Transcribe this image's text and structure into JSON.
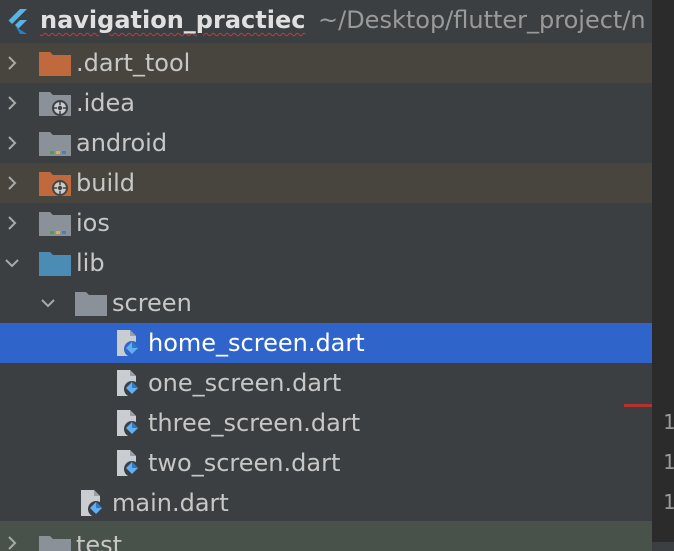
{
  "project": {
    "name": "navigation_practiec",
    "path": "~/Desktop/flutter_project/n"
  },
  "tree": [
    {
      "label": ".dart_tool",
      "icon": "folder-excluded-icon",
      "expanded": false
    },
    {
      "label": ".idea",
      "icon": "folder-settings-icon",
      "expanded": false
    },
    {
      "label": "android",
      "icon": "folder-android-icon",
      "expanded": false
    },
    {
      "label": "build",
      "icon": "folder-build-icon",
      "expanded": false
    },
    {
      "label": "ios",
      "icon": "folder-ios-icon",
      "expanded": false
    },
    {
      "label": "lib",
      "icon": "folder-source-icon",
      "expanded": true
    },
    {
      "label": "screen",
      "icon": "folder-icon",
      "expanded": true
    },
    {
      "label": "home_screen.dart",
      "icon": "dart-file-icon",
      "selected": true
    },
    {
      "label": "one_screen.dart",
      "icon": "dart-file-icon"
    },
    {
      "label": "three_screen.dart",
      "icon": "dart-file-icon"
    },
    {
      "label": "two_screen.dart",
      "icon": "dart-file-icon"
    },
    {
      "label": "main.dart",
      "icon": "dart-file-icon"
    },
    {
      "label": "test",
      "icon": "folder-test-icon",
      "expanded": false
    }
  ],
  "gutter": {
    "numbers": [
      "1",
      "1",
      "1"
    ]
  },
  "colors": {
    "background": "#3c3f41",
    "selected_row": "#2f65ca",
    "excluded_row": "#47453e",
    "excluded_folder": "#c0693d",
    "source_folder": "#4b8cb5",
    "plain_folder": "#8a9199"
  }
}
